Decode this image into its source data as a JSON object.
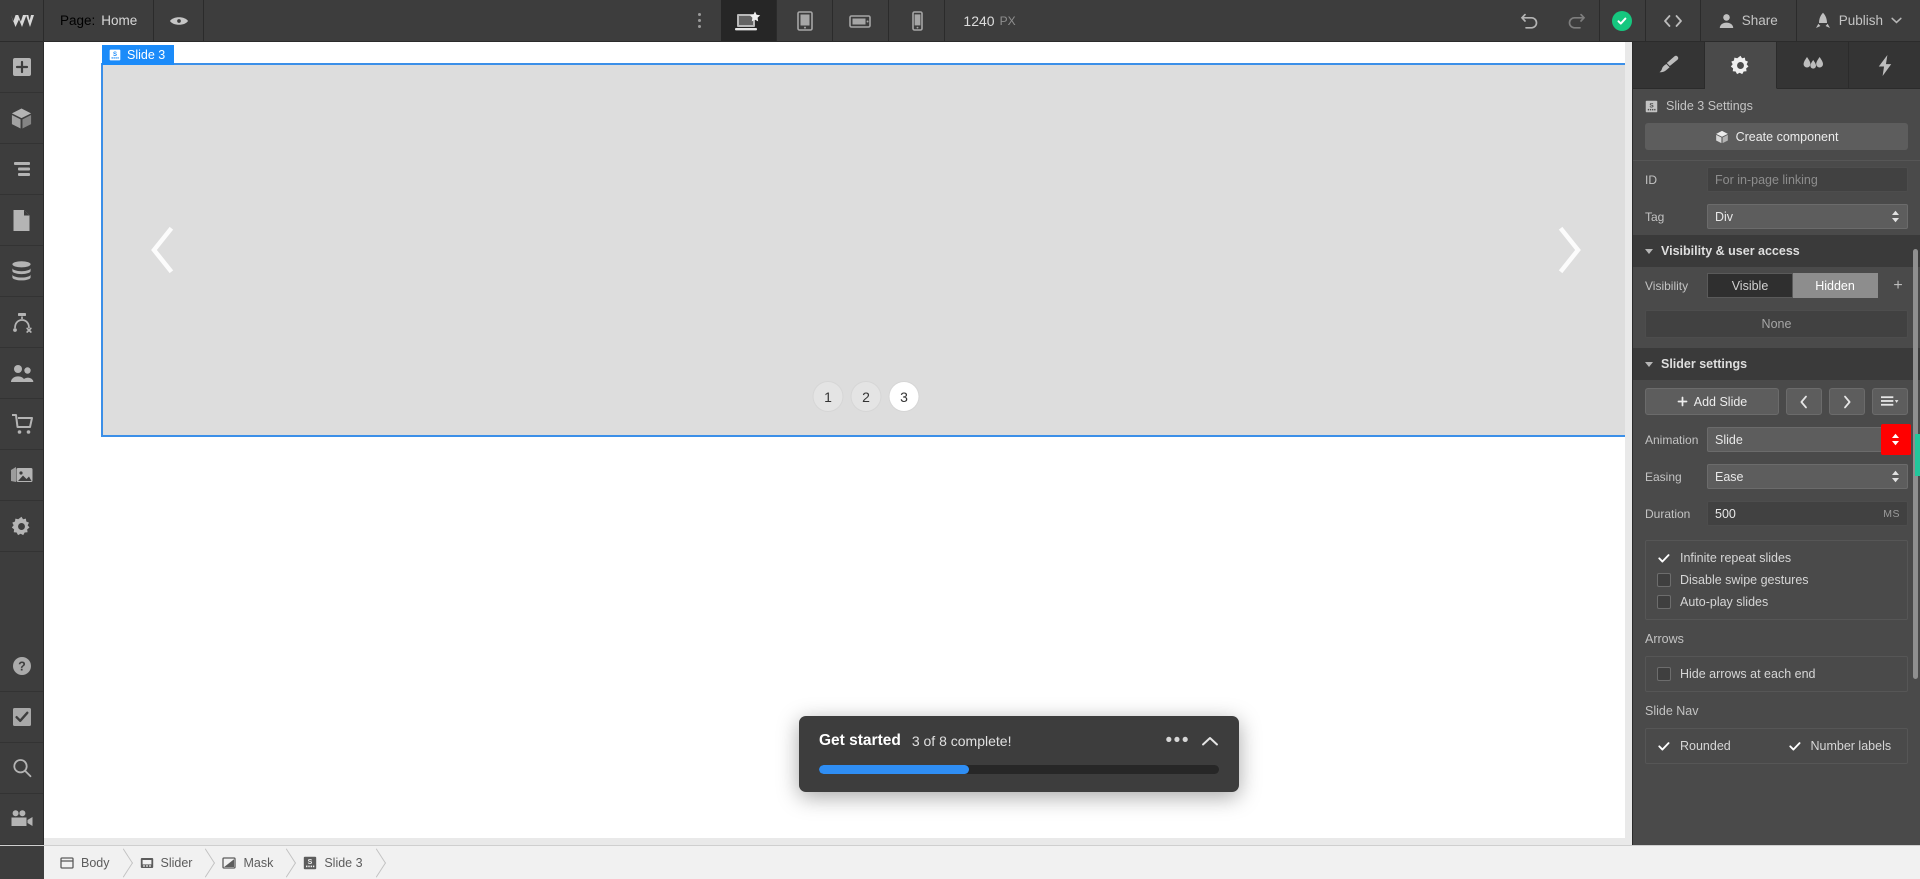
{
  "topbar": {
    "logo": "W",
    "page_label": "Page:",
    "page_name": "Home",
    "preview_icon": "eye-icon",
    "more_icon": "kebab-menu-icon",
    "breakpoints": [
      {
        "name": "desktop",
        "icon": "desktop-breakpoint-icon",
        "active": true
      },
      {
        "name": "tablet",
        "icon": "tablet-breakpoint-icon",
        "active": false
      },
      {
        "name": "mobile-landscape",
        "icon": "mobile-landscape-breakpoint-icon",
        "active": false
      },
      {
        "name": "mobile-portrait",
        "icon": "mobile-portrait-breakpoint-icon",
        "active": false
      }
    ],
    "zoom_value": "1240",
    "zoom_unit": "PX",
    "undo_icon": "undo-icon",
    "redo_icon": "redo-icon",
    "status_icon": "saved-check-icon",
    "code_icon": "code-export-icon",
    "share_label": "Share",
    "publish_label": "Publish",
    "accent_blue": "#1b8bf9",
    "accent_green": "#16c77f"
  },
  "left_rail": {
    "top_items": [
      {
        "name": "add-elements",
        "icon": "plus-square-icon"
      },
      {
        "name": "components",
        "icon": "cube-icon"
      },
      {
        "name": "navigator",
        "icon": "layers-icon"
      },
      {
        "name": "pages",
        "icon": "page-icon"
      },
      {
        "name": "cms",
        "icon": "database-icon"
      },
      {
        "name": "logic",
        "icon": "logic-flow-icon"
      },
      {
        "name": "users",
        "icon": "users-icon"
      },
      {
        "name": "ecommerce",
        "icon": "shopping-cart-icon"
      },
      {
        "name": "assets",
        "icon": "images-icon"
      },
      {
        "name": "settings",
        "icon": "gear-icon"
      }
    ],
    "bottom_items": [
      {
        "name": "help",
        "icon": "question-circle-icon"
      },
      {
        "name": "audit",
        "icon": "checkbox-audit-icon"
      },
      {
        "name": "search",
        "icon": "search-icon"
      },
      {
        "name": "video",
        "icon": "video-camera-icon"
      }
    ]
  },
  "canvas": {
    "element_badge": "Slide 3",
    "element_badge_icon": "slide-icon",
    "prev_arrow_icon": "chevron-left-icon",
    "next_arrow_icon": "chevron-right-icon",
    "slide_nav": [
      {
        "label": "1",
        "active": false
      },
      {
        "label": "2",
        "active": false
      },
      {
        "label": "3",
        "active": true
      }
    ],
    "slide_bg": "#dddddd",
    "selection_color": "#3b8fe8"
  },
  "get_started": {
    "title": "Get started",
    "subtitle": "3 of 8 complete!",
    "more_icon": "ellipsis-icon",
    "collapse_icon": "chevron-up-icon",
    "progress_percent": 37.5,
    "progress_color": "#2f8ef4"
  },
  "panel": {
    "tabs": [
      {
        "name": "style",
        "icon": "paintbrush-icon",
        "active": false
      },
      {
        "name": "settings",
        "icon": "gear-icon",
        "active": true
      },
      {
        "name": "interactions",
        "icon": "droplets-icon",
        "active": false
      },
      {
        "name": "effects",
        "icon": "lightning-bolt-icon",
        "active": false
      }
    ],
    "header": {
      "icon": "slide-icon",
      "title": "Slide 3 Settings"
    },
    "create_component": {
      "label": "Create component",
      "icon": "cube-icon"
    },
    "id_row": {
      "label": "ID",
      "value": "",
      "placeholder": "For in-page linking"
    },
    "tag_row": {
      "label": "Tag",
      "value": "Div"
    },
    "visibility_section": {
      "title": "Visibility & user access",
      "label": "Visibility",
      "options": [
        {
          "label": "Visible",
          "selected": false
        },
        {
          "label": "Hidden",
          "selected": true
        }
      ],
      "add_icon": "plus-icon",
      "condition_value": "None"
    },
    "slider_section": {
      "title": "Slider settings",
      "add_slide_label": "Add Slide",
      "add_slide_icon": "plus-icon",
      "prev_icon": "chevron-left-icon",
      "next_icon": "chevron-right-icon",
      "list_icon": "slide-list-dropdown-icon",
      "animation_label": "Animation",
      "animation_value": "Slide",
      "easing_label": "Easing",
      "easing_value": "Ease",
      "duration_label": "Duration",
      "duration_value": "500",
      "duration_unit": "MS",
      "checkboxes": [
        {
          "label": "Infinite repeat slides",
          "checked": true
        },
        {
          "label": "Disable swipe gestures",
          "checked": false
        },
        {
          "label": "Auto-play slides",
          "checked": false
        }
      ],
      "arrows_label": "Arrows",
      "arrows_checkboxes": [
        {
          "label": "Hide arrows at each end",
          "checked": false
        }
      ],
      "slide_nav_label": "Slide Nav",
      "slide_nav_checkboxes": [
        {
          "label": "Rounded",
          "checked": true
        },
        {
          "label": "Number labels",
          "checked": true
        }
      ]
    },
    "highlight_color": "#ff0000"
  },
  "breadcrumb": {
    "items": [
      {
        "label": "Body",
        "icon": "body-icon"
      },
      {
        "label": "Slider",
        "icon": "slider-icon"
      },
      {
        "label": "Mask",
        "icon": "mask-icon"
      },
      {
        "label": "Slide 3",
        "icon": "slide-icon"
      }
    ]
  }
}
